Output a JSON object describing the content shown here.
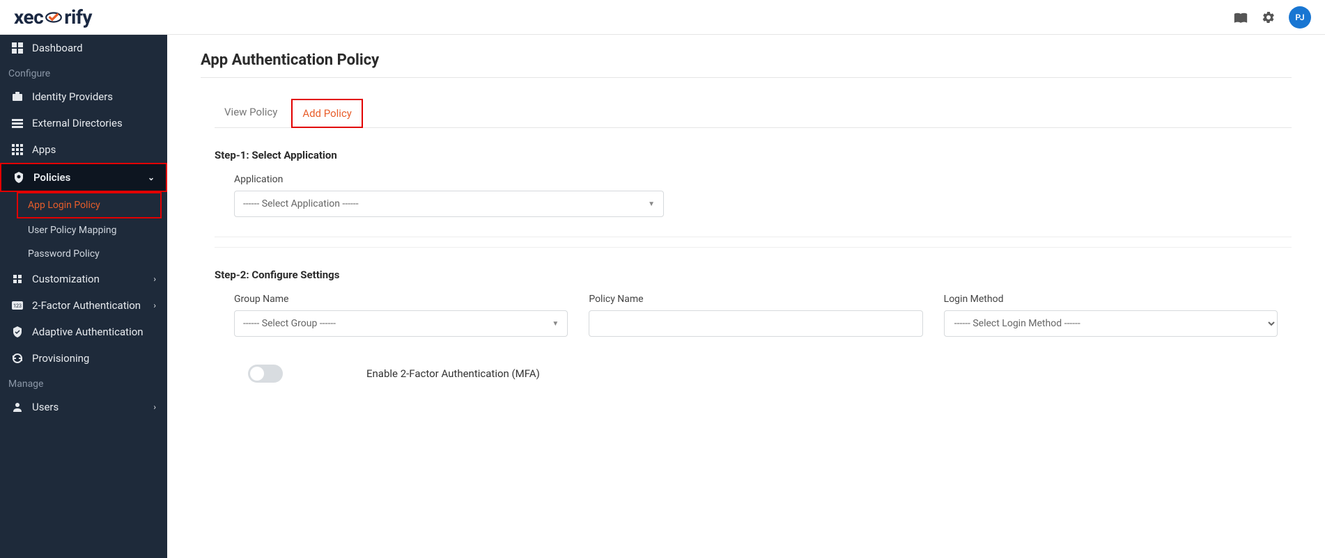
{
  "topbar": {
    "logo_pre": "xec",
    "logo_post": "rify",
    "avatar": "PJ"
  },
  "sidebar": {
    "dashboard": "Dashboard",
    "section_configure": "Configure",
    "identity_providers": "Identity Providers",
    "external_directories": "External Directories",
    "apps": "Apps",
    "policies": "Policies",
    "policies_sub": {
      "app_login": "App Login Policy",
      "user_mapping": "User Policy Mapping",
      "password": "Password Policy"
    },
    "customization": "Customization",
    "two_factor": "2-Factor Authentication",
    "adaptive": "Adaptive Authentication",
    "provisioning": "Provisioning",
    "section_manage": "Manage",
    "users": "Users"
  },
  "page": {
    "title": "App Authentication Policy",
    "tabs": {
      "view": "View Policy",
      "add": "Add Policy"
    },
    "step1": {
      "title": "Step-1: Select Application",
      "app_label": "Application",
      "app_placeholder": "------ Select Application ------"
    },
    "step2": {
      "title": "Step-2: Configure Settings",
      "group_label": "Group Name",
      "group_placeholder": "------ Select Group ------",
      "policy_label": "Policy Name",
      "login_label": "Login Method",
      "login_placeholder": "------ Select Login Method ------",
      "mfa_label": "Enable 2-Factor Authentication (MFA)"
    }
  }
}
